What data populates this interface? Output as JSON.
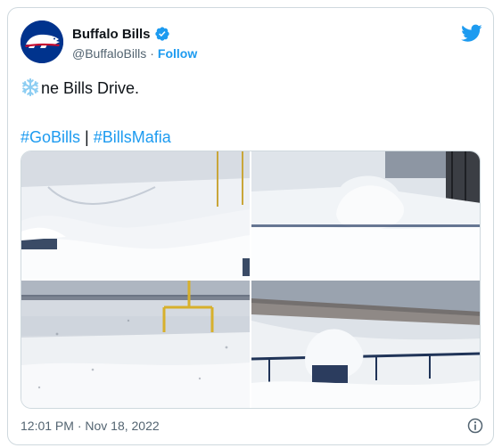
{
  "account": {
    "display_name": "Buffalo Bills",
    "handle": "@BuffaloBills",
    "separator": "·",
    "follow_label": "Follow"
  },
  "tweet": {
    "text_after_emoji": "ne Bills Drive.",
    "hashtags": [
      "#GoBills",
      "#BillsMafia"
    ],
    "hashtag_separator": "|",
    "timestamp": "12:01 PM · Nov 18, 2022"
  },
  "icons": {
    "avatar": "buffalo-logo",
    "verified": "verified-badge-icon",
    "platform": "twitter-bird-icon",
    "emoji": "snowflake-icon",
    "info": "info-icon"
  },
  "colors": {
    "accent": "#1d9bf0",
    "bills_blue": "#00338d",
    "bills_red": "#c60c30",
    "text": "#0f1419",
    "muted": "#536471",
    "border": "#cfd9de"
  }
}
